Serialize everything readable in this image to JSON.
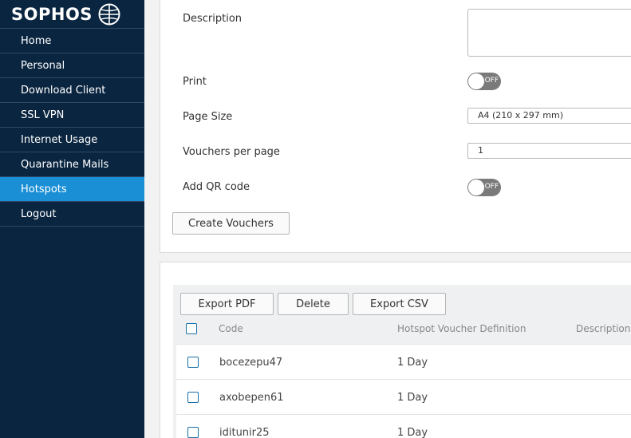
{
  "sidebar": {
    "logo": "SOPHOS",
    "items": [
      {
        "label": "Home"
      },
      {
        "label": "Personal"
      },
      {
        "label": "Download Client"
      },
      {
        "label": "SSL VPN"
      },
      {
        "label": "Internet Usage"
      },
      {
        "label": "Quarantine Mails"
      },
      {
        "label": "Hotspots",
        "active": true
      },
      {
        "label": "Logout"
      }
    ]
  },
  "form": {
    "description_label": "Description",
    "print_label": "Print",
    "print_toggle": "OFF",
    "page_size_label": "Page Size",
    "page_size_value": "A4 (210 x 297 mm)",
    "vouchers_per_page_label": "Vouchers per page",
    "vouchers_per_page_value": "1",
    "qr_label": "Add QR code",
    "qr_toggle": "OFF",
    "create_button": "Create Vouchers"
  },
  "grid": {
    "export_pdf": "Export PDF",
    "delete": "Delete",
    "export_csv": "Export CSV",
    "columns": [
      "Code",
      "Hotspot Voucher Definition",
      "Description"
    ],
    "rows": [
      {
        "code": "bocezepu47",
        "definition": "1 Day"
      },
      {
        "code": "axobepen61",
        "definition": "1 Day"
      },
      {
        "code": "iditunir25",
        "definition": "1 Day"
      }
    ]
  },
  "colors": {
    "sidebar_bg": "#0a2540",
    "active_item": "#1a8fd6",
    "toggle_off": "#7a7a7a"
  }
}
